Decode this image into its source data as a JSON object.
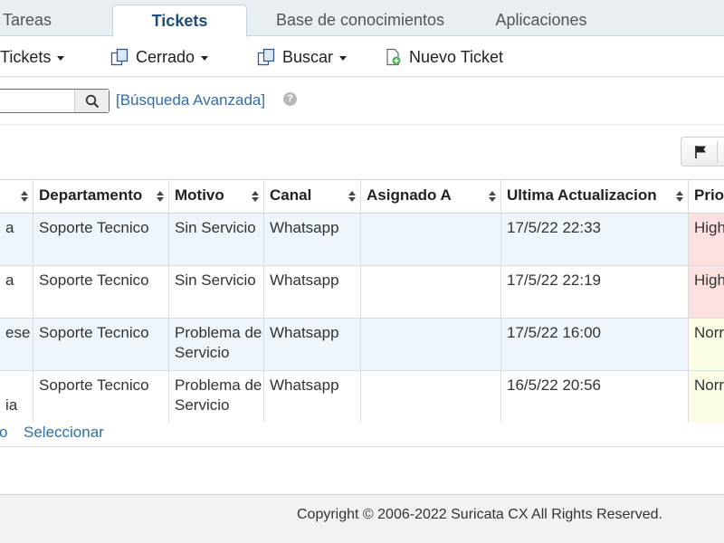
{
  "tabs": [
    {
      "label": "Tareas"
    },
    {
      "label": "Tickets"
    },
    {
      "label": "Base de conocimientos"
    },
    {
      "label": "Aplicaciones"
    }
  ],
  "toolbar": {
    "tickets_label": "Tickets",
    "cerrado_label": "Cerrado",
    "buscar_label": "Buscar",
    "nuevo_label": "Nuevo Ticket"
  },
  "search": {
    "value": "",
    "advanced_link": "[Búsqueda Avanzada]"
  },
  "table": {
    "headers": [
      {
        "label": ""
      },
      {
        "label": "Departamento"
      },
      {
        "label": "Motivo"
      },
      {
        "label": "Canal"
      },
      {
        "label": "Asignado A"
      },
      {
        "label": "Ultima Actualizacion"
      },
      {
        "label": "Prio"
      }
    ],
    "rows": [
      {
        "c0": "a",
        "departamento": "Soporte Tecnico",
        "motivo": "Sin Servicio",
        "canal": "Whatsapp",
        "asignado": "",
        "actualizacion": "17/5/22 22:33",
        "prioridad": "High"
      },
      {
        "c0": "a",
        "departamento": "Soporte Tecnico",
        "motivo": "Sin Servicio",
        "canal": "Whatsapp",
        "asignado": "",
        "actualizacion": "17/5/22 22:19",
        "prioridad": "High"
      },
      {
        "c0": "ese",
        "departamento": "Soporte Tecnico",
        "motivo": "Problema de Servicio",
        "canal": "Whatsapp",
        "asignado": "",
        "actualizacion": "17/5/22 16:00",
        "prioridad": "Norr"
      },
      {
        "c0": "ia",
        "departamento": "Soporte Tecnico",
        "motivo": "Problema de Servicio",
        "canal": "Whatsapp",
        "asignado": "",
        "actualizacion": "16/5/22 20:56",
        "prioridad": "Norr"
      }
    ]
  },
  "links": {
    "left": "o",
    "select": "Seleccionar"
  },
  "footer": {
    "copyright": "Copyright © 2006-2022 Suricata CX All Rights Reserved."
  },
  "colors": {
    "accent": "#1f4e79",
    "link": "#2f6fa7",
    "row_alt": "#eef5fb",
    "priority_high": "#fde1e1",
    "priority_normal": "#fdfde6"
  },
  "icons": {
    "tickets": "copy-icon",
    "cerrado": "copy-icon",
    "buscar": "copy-icon",
    "nuevo": "document-add-icon",
    "search": "search-icon",
    "help": "help-icon",
    "flag": "flag-icon"
  }
}
